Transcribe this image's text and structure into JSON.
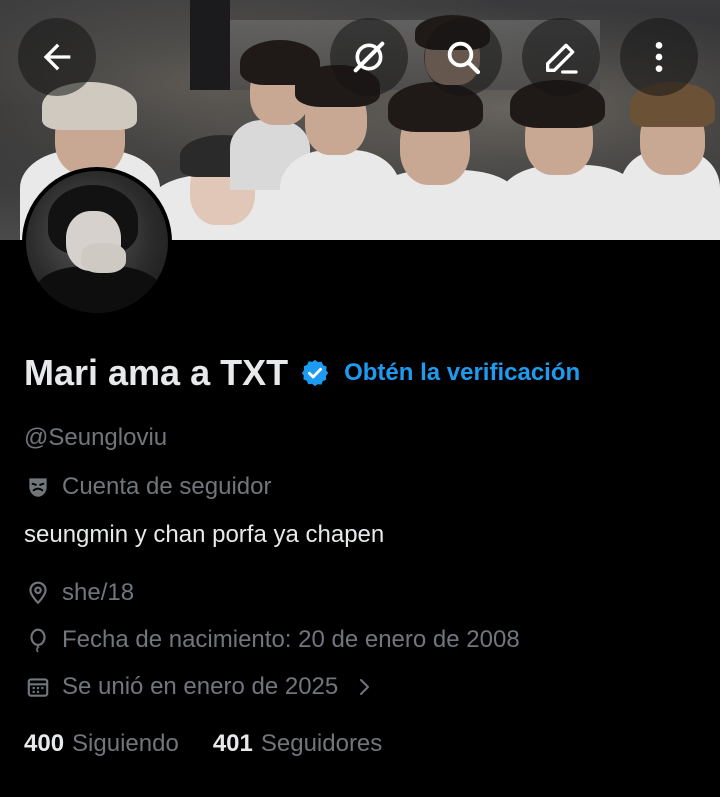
{
  "header": {
    "back_icon": "arrow-left-icon",
    "grok_icon": "grok-icon",
    "search_icon": "search-icon",
    "edit_icon": "edit-pencil-icon",
    "more_icon": "more-vertical-icon"
  },
  "profile": {
    "display_name": "Mari ama a TXT",
    "verified_badge_icon": "verified-badge-icon",
    "get_verified_label": "Obtén la verificación",
    "handle": "@Seungloviu",
    "account_type": "Cuenta de seguidor",
    "bio": "seungmin y chan porfa ya chapen",
    "location": "she/18",
    "birthdate": "Fecha de nacimiento: 20 de enero de 2008",
    "joined": "Se unió en enero de 2025",
    "following_count": "400",
    "following_label": "Siguiendo",
    "followers_count": "401",
    "followers_label": "Seguidores"
  },
  "colors": {
    "background": "#000000",
    "primary_text": "#e7e9ea",
    "secondary_text": "#71767b",
    "accent": "#1d9bf0"
  }
}
